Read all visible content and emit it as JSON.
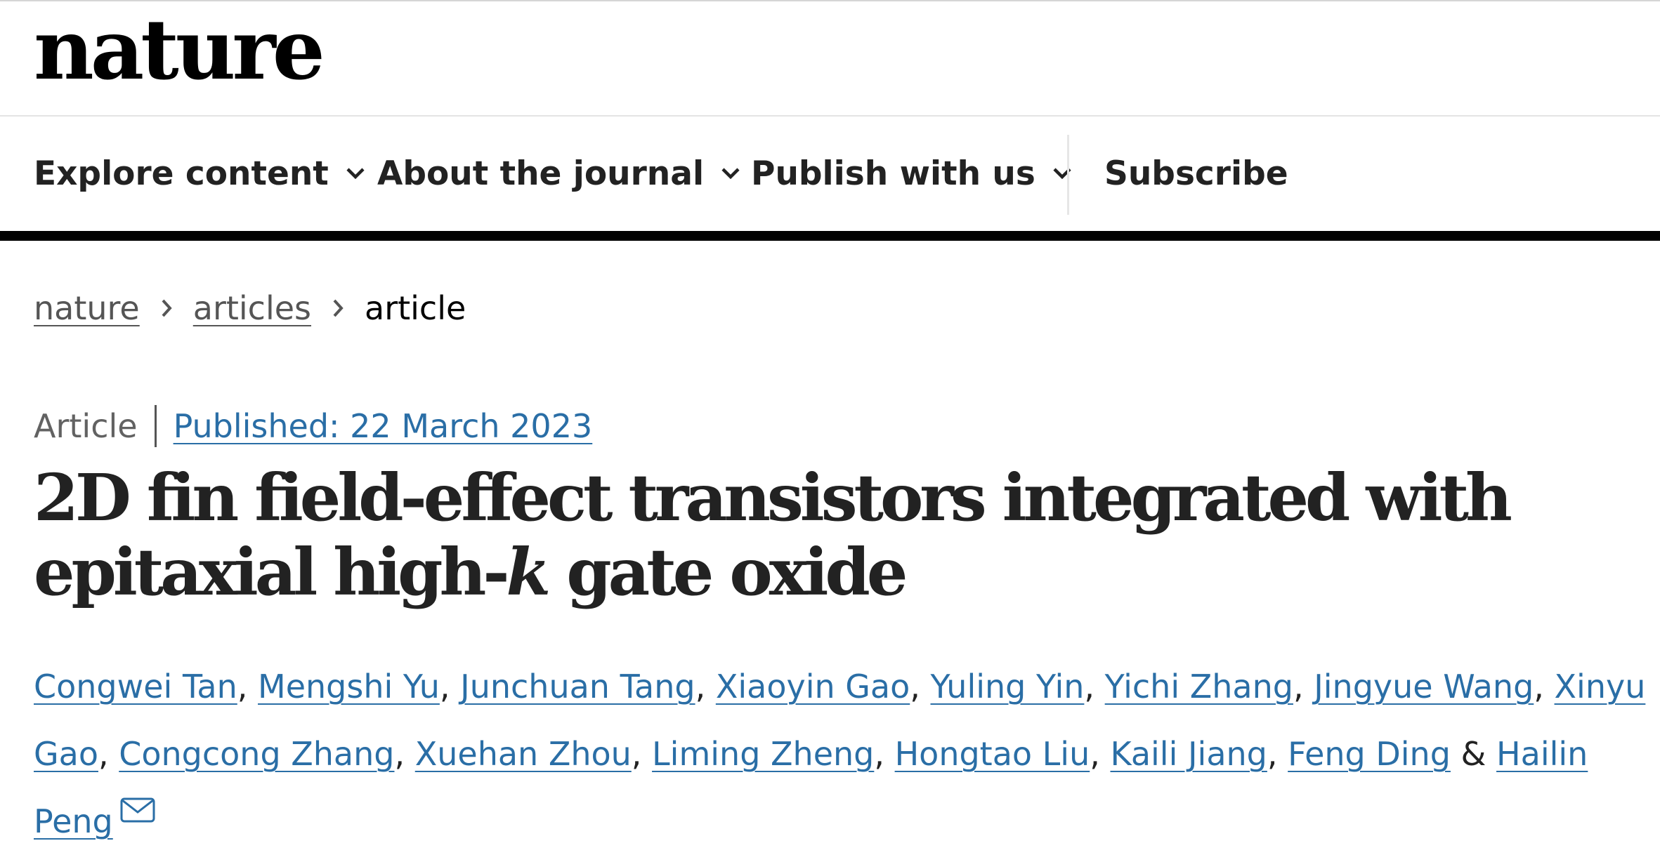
{
  "brand": {
    "logo_text": "nature"
  },
  "nav": {
    "items": [
      {
        "label": "Explore content",
        "has_dropdown": true
      },
      {
        "label": "About the journal",
        "has_dropdown": true
      },
      {
        "label": "Publish with us",
        "has_dropdown": true
      },
      {
        "label": "Subscribe",
        "has_dropdown": false
      }
    ]
  },
  "breadcrumb": {
    "items": [
      "nature",
      "articles"
    ],
    "current": "article"
  },
  "article": {
    "type": "Article",
    "published": "Published: 22 March 2023",
    "title_pre": "2D fin field-effect transistors integrated with epitaxial high-",
    "title_italic": "k",
    "title_post": " gate oxide"
  },
  "authors": {
    "names": [
      "Congwei Tan",
      "Mengshi Yu",
      "Junchuan Tang",
      "Xiaoyin Gao",
      "Yuling Yin",
      "Yichi Zhang",
      "Jingyue Wang",
      "Xinyu Gao",
      "Congcong Zhang",
      "Xuehan Zhou",
      "Liming Zheng",
      "Hongtao Liu",
      "Kaili Jiang",
      "Feng Ding",
      "Hailin Peng"
    ],
    "separator": ",",
    "last_separator": "&",
    "corresponding_icon": "mail-icon"
  },
  "colors": {
    "link": "#2a6ea6",
    "text": "#222222",
    "nav_bottom_bar": "#000000"
  }
}
